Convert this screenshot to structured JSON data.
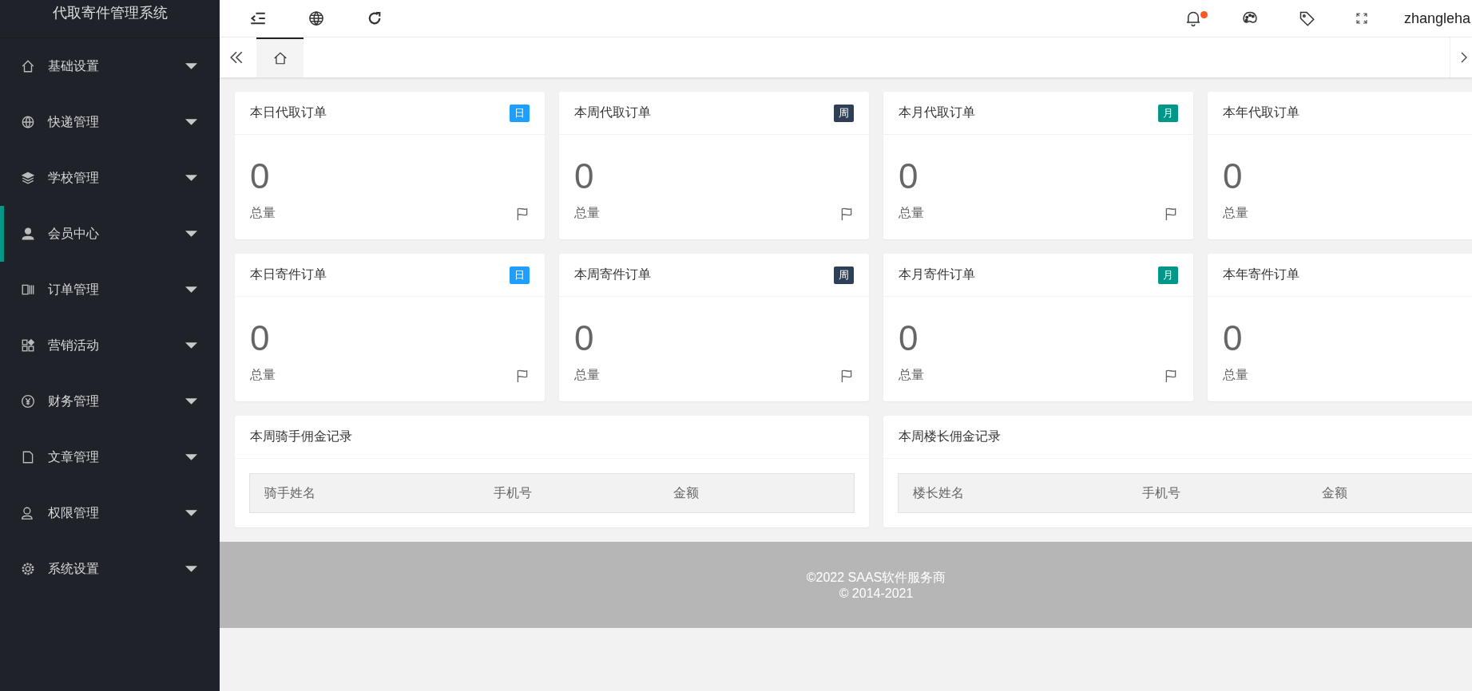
{
  "sidebar": {
    "title": "代取寄件管理系统",
    "items": [
      {
        "label": "基础设置",
        "selected": false
      },
      {
        "label": "快递管理",
        "selected": false
      },
      {
        "label": "学校管理",
        "selected": false
      },
      {
        "label": "会员中心",
        "selected": true
      },
      {
        "label": "订单管理",
        "selected": false
      },
      {
        "label": "营销活动",
        "selected": false
      },
      {
        "label": "财务管理",
        "selected": false
      },
      {
        "label": "文章管理",
        "selected": false
      },
      {
        "label": "权限管理",
        "selected": false
      },
      {
        "label": "系统设置",
        "selected": false
      }
    ]
  },
  "header": {
    "notification_dot": true,
    "username": "zhangleha"
  },
  "tabs": [
    {
      "kind": "home",
      "selected": true
    }
  ],
  "stat_cards": [
    {
      "title": "本日代取订单",
      "badge": {
        "text": "日",
        "kind": "day"
      },
      "value": "0",
      "caption": "总量"
    },
    {
      "title": "本周代取订单",
      "badge": {
        "text": "周",
        "kind": "week"
      },
      "value": "0",
      "caption": "总量"
    },
    {
      "title": "本月代取订单",
      "badge": {
        "text": "月",
        "kind": "month"
      },
      "value": "0",
      "caption": "总量"
    },
    {
      "title": "本年代取订单",
      "value": "0",
      "caption": "总量"
    },
    {
      "title": "本日寄件订单",
      "badge": {
        "text": "日",
        "kind": "day"
      },
      "value": "0",
      "caption": "总量"
    },
    {
      "title": "本周寄件订单",
      "badge": {
        "text": "周",
        "kind": "week"
      },
      "value": "0",
      "caption": "总量"
    },
    {
      "title": "本月寄件订单",
      "badge": {
        "text": "月",
        "kind": "month"
      },
      "value": "0",
      "caption": "总量"
    },
    {
      "title": "本年寄件订单",
      "value": "0",
      "caption": "总量"
    }
  ],
  "tables": [
    {
      "title": "本周骑手佣金记录",
      "columns": [
        "骑手姓名",
        "手机号",
        "金额"
      ]
    },
    {
      "title": "本周楼长佣金记录",
      "columns": [
        "楼长姓名",
        "手机号",
        "金额"
      ]
    }
  ],
  "footer": {
    "lines": [
      "©2022 SAAS软件服务商",
      "© 2014-2021"
    ]
  }
}
